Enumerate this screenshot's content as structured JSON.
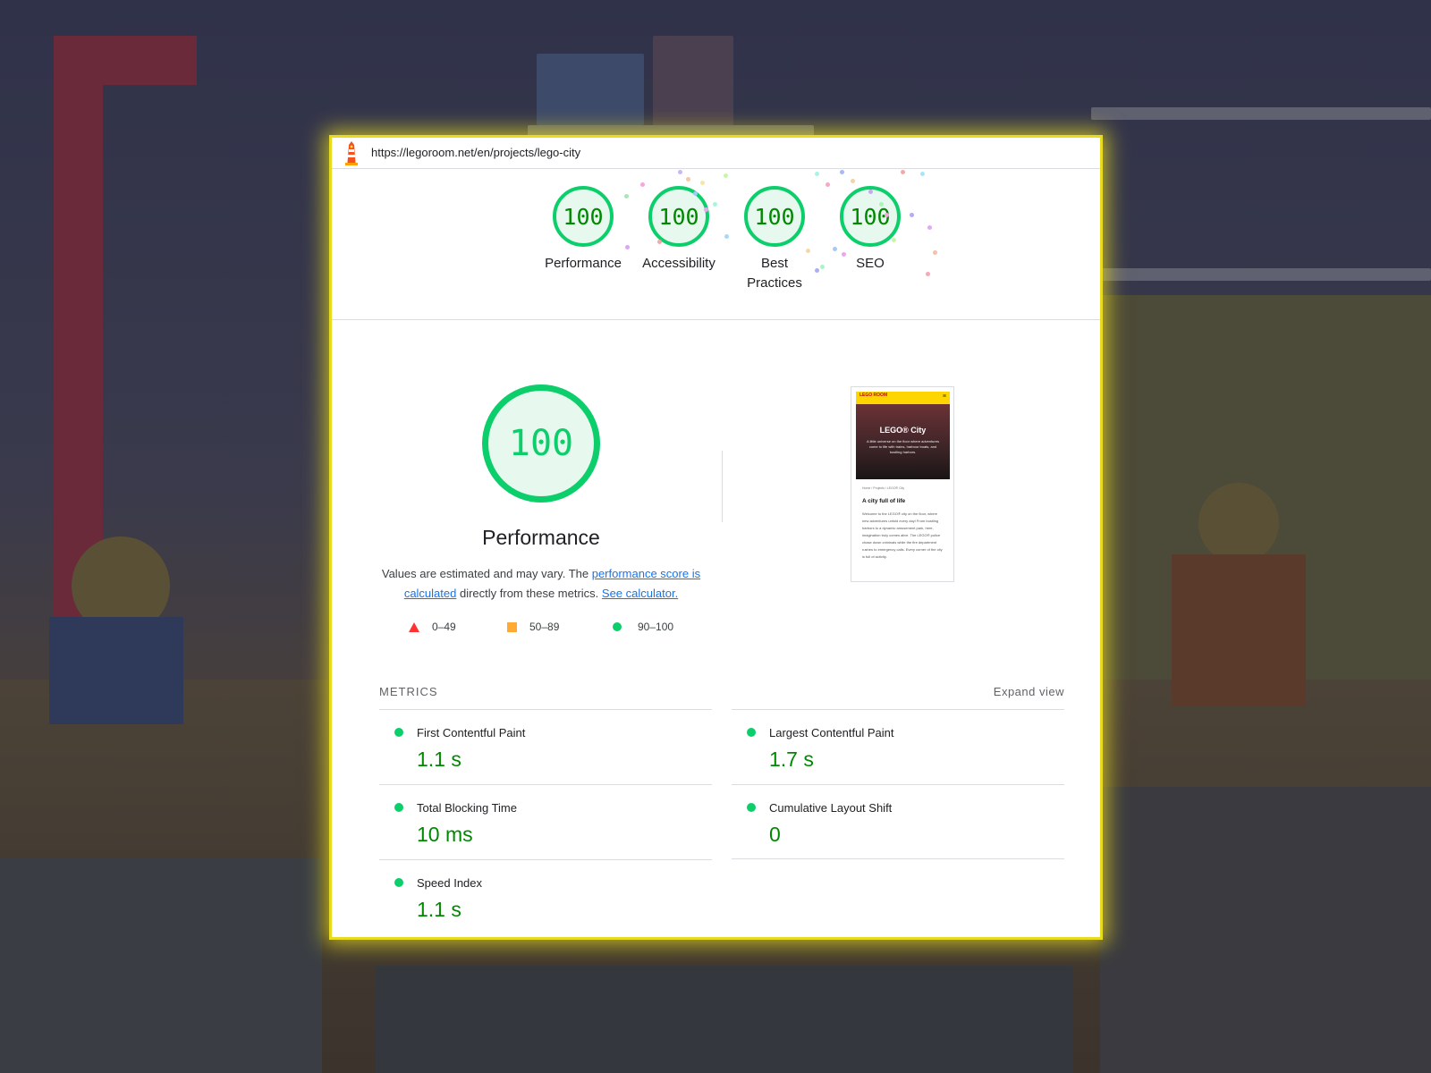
{
  "browser": {
    "url": "https://legoroom.net/en/projects/lego-city",
    "logo_icon": "lighthouse-icon"
  },
  "categories": [
    {
      "label": "Performance",
      "score": "100"
    },
    {
      "label": "Accessibility",
      "score": "100"
    },
    {
      "label": "Best Practices",
      "score": "100"
    },
    {
      "label": "SEO",
      "score": "100"
    }
  ],
  "performance": {
    "score": "100",
    "title": "Performance",
    "desc_prefix": "Values are estimated and may vary. The ",
    "desc_link1": "performance score is calculated",
    "desc_middle": " directly from these metrics. ",
    "desc_link2": "See calculator."
  },
  "legend": [
    {
      "range": "0–49",
      "icon": "triangle-fail-icon",
      "color": "#ff3333"
    },
    {
      "range": "50–89",
      "icon": "square-average-icon",
      "color": "#ffaa33"
    },
    {
      "range": "90–100",
      "icon": "circle-pass-icon",
      "color": "#0cce6b"
    }
  ],
  "preview": {
    "logo": "LEGO ROOM",
    "hero_title": "LEGO® City",
    "hero_sub": "A little universe on the floor where adventures come to life with trains, harbour boats, and bustling harbors.",
    "breadcrumb": "Home / Projects / LEGO® City",
    "heading": "A city full of life",
    "body": "Welcome to the LEGO® city on the floor, where new adventures unfold every day! From bustling harbors to a dynamic amusement park, here, imagination truly comes alive. The LEGO® police chase down criminals while the fire department rushes to emergency calls. Every corner of the city is full of activity."
  },
  "metrics": {
    "heading": "METRICS",
    "expand": "Expand view",
    "items": [
      {
        "name": "First Contentful Paint",
        "value": "1.1 s"
      },
      {
        "name": "Largest Contentful Paint",
        "value": "1.7 s"
      },
      {
        "name": "Total Blocking Time",
        "value": "10 ms"
      },
      {
        "name": "Cumulative Layout Shift",
        "value": "0"
      },
      {
        "name": "Speed Index",
        "value": "1.1 s"
      }
    ]
  },
  "colors": {
    "pass": "#0cce6b",
    "pass_text": "#008800",
    "highlight_border": "#e8da1c",
    "link": "#1a73e8"
  }
}
